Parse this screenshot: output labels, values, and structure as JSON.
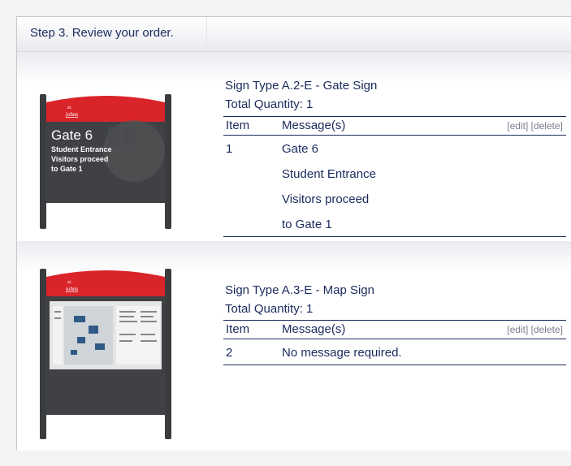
{
  "header": {
    "step_title": "Step 3. Review your order."
  },
  "orders": [
    {
      "sign_type": "Sign Type A.2-E - Gate Sign",
      "total_quantity": "Total Quantity: 1",
      "col_item": "Item",
      "col_messages": "Message(s)",
      "edit_label": "[edit]",
      "delete_label": "[delete]",
      "item_number": "1",
      "messages": [
        "Gate 6",
        "Student Entrance",
        "Visitors proceed",
        "to Gate 1"
      ],
      "image": {
        "logo_line1": "st.",
        "logo_line2": "johns",
        "big_text": "Gate 6",
        "small_lines": [
          "Student Entrance",
          "Visitors proceed",
          "to Gate 1"
        ]
      }
    },
    {
      "sign_type": "Sign Type A.3-E - Map Sign",
      "total_quantity": "Total Quantity: 1",
      "col_item": "Item",
      "col_messages": "Message(s)",
      "edit_label": "[edit]",
      "delete_label": "[delete]",
      "item_number": "2",
      "messages": [
        "No message required."
      ],
      "image": {
        "logo_line1": "st.",
        "logo_line2": "johns"
      }
    }
  ],
  "colors": {
    "text_navy": "#1a2a5c",
    "sign_red": "#d9242a",
    "sign_dark": "#3e4043",
    "action_gray": "#7a7f8c"
  }
}
